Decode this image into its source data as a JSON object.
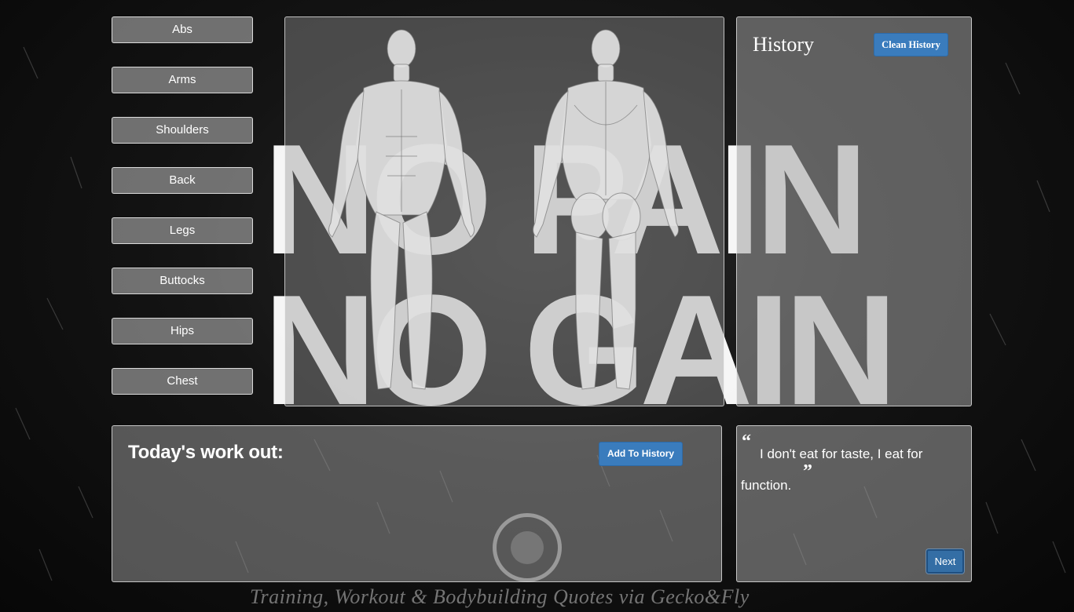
{
  "menu": {
    "items": [
      "Abs",
      "Arms",
      "Shoulders",
      "Back",
      "Legs",
      "Buttocks",
      "Hips",
      "Chest"
    ]
  },
  "background": {
    "poster_line1": "NO PAIN",
    "poster_line2": "NO GAIN",
    "caption": "Training, Workout & Bodybuilding Quotes via Gecko&Fly"
  },
  "anatomy": {
    "front_icon": "anatomy-front-icon",
    "back_icon": "anatomy-back-icon"
  },
  "history": {
    "title": "History",
    "clear_label": "Clean History"
  },
  "workout": {
    "title": "Today's work out:",
    "add_label": "Add To History"
  },
  "quote": {
    "open_mark": "“",
    "text": "I don't eat for taste, I eat for function.",
    "close_mark": "”",
    "next_label": "Next"
  },
  "colors": {
    "accent": "#3a7cbd",
    "panel": "#a0a0a0",
    "background": "#0b0b0b"
  }
}
